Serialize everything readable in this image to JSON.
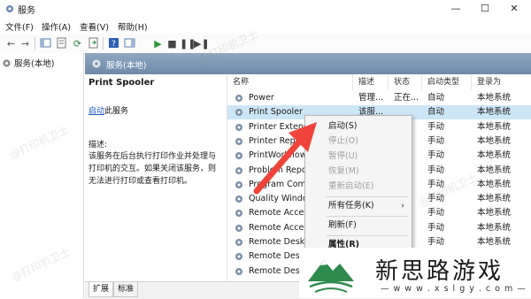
{
  "window": {
    "title": "服务",
    "controls": [
      "—",
      "☐",
      "✕"
    ]
  },
  "menu": [
    "文件(F)",
    "操作(A)",
    "查看(V)",
    "帮助(H)"
  ],
  "tree": {
    "root": "服务(本地)"
  },
  "header": {
    "title": "服务(本地)"
  },
  "detail": {
    "service_name": "Print Spooler",
    "start_link": "启动",
    "start_suffix": "此服务",
    "desc_label": "描述:",
    "desc_text": "该服务在后台执行打印作业并处理与打印机的交互。如果关闭该服务，则无法进行打印或查看打印机。"
  },
  "columns": [
    "名称",
    "描述",
    "状态",
    "启动类型",
    "登录为"
  ],
  "services": [
    {
      "name": "Power",
      "desc": "管理...",
      "status": "正在...",
      "startup": "自动",
      "logon": "本地系统"
    },
    {
      "name": "Print Spooler",
      "desc": "该服...",
      "status": "",
      "startup": "自动",
      "logon": "本地系统"
    },
    {
      "name": "Printer Extensio",
      "desc": "",
      "status": "",
      "startup": "手动",
      "logon": "本地系统"
    },
    {
      "name": "Printer Repa",
      "desc": "",
      "status": "",
      "startup": "手动",
      "logon": "本地系统"
    },
    {
      "name": "PrintWorkflow_",
      "desc": "",
      "status": "",
      "startup": "手动",
      "logon": "本地系统"
    },
    {
      "name": "Problem Repor",
      "desc": "",
      "status": "",
      "startup": "手动",
      "logon": "本地系统"
    },
    {
      "name": "Program Comp",
      "desc": "",
      "status": "",
      "startup": "手动",
      "logon": "本地系统"
    },
    {
      "name": "Quality Windov",
      "desc": "",
      "status": "",
      "startup": "手动",
      "logon": "本地系统"
    },
    {
      "name": "Remote Access",
      "desc": "",
      "status": "",
      "startup": "手动",
      "logon": "本地系统"
    },
    {
      "name": "Remote Access",
      "desc": "",
      "status": "",
      "startup": "手动",
      "logon": "本地系统"
    },
    {
      "name": "Remote Deskto",
      "desc": "",
      "status": "",
      "startup": "手动",
      "logon": "本地系统"
    },
    {
      "name": "Remote Deskto",
      "desc": "",
      "status": "",
      "startup": "手动",
      "logon": "本地系统"
    },
    {
      "name": "Remote Deskto",
      "desc": "",
      "status": "",
      "startup": "手动",
      "logon": "本地系统"
    }
  ],
  "context_menu": {
    "start": "启动(S)",
    "stop": "停止(O)",
    "pause": "暂停(U)",
    "resume": "恢复(M)",
    "restart": "重新启动(E)",
    "all_tasks": "所有任务(K)",
    "all_tasks_arrow": "›",
    "refresh": "刷新(F)",
    "properties": "属性(R)"
  },
  "tabs": [
    "扩展",
    "标准"
  ],
  "watermark": "@打印机卫士",
  "brand": {
    "name": "新思路游戏",
    "url": "— w w w . x s l g y . c o m —"
  },
  "colors": {
    "selected_row": "#cde6f7",
    "header_gradient": "#7a93b2",
    "arrow": "#f0443a",
    "brand_green": "#2f8a4e",
    "link": "#1e5bbf"
  }
}
